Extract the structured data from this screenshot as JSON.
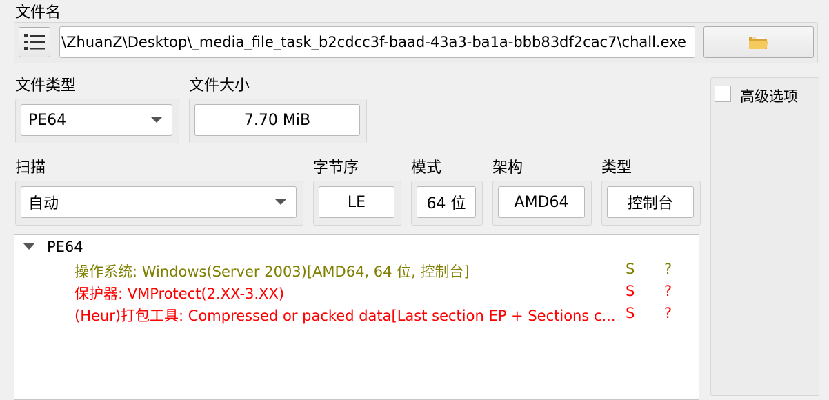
{
  "file": {
    "label": "文件名",
    "path": "\\ZhuanZ\\Desktop\\_media_file_task_b2cdcc3f-baad-43a3-ba1a-bbb83df2cac7\\chall.exe"
  },
  "file_type": {
    "label": "文件类型",
    "value": "PE64"
  },
  "file_size": {
    "label": "文件大小",
    "value": "7.70 MiB"
  },
  "scan": {
    "label": "扫描",
    "value": "自动"
  },
  "endianness": {
    "label": "字节序",
    "value": "LE"
  },
  "mode": {
    "label": "模式",
    "value": "64 位"
  },
  "arch": {
    "label": "架构",
    "value": "AMD64"
  },
  "type": {
    "label": "类型",
    "value": "控制台"
  },
  "advanced": {
    "label": "高级选项",
    "checked": false
  },
  "results": {
    "root": "PE64",
    "items": [
      {
        "text": "操作系统: Windows(Server 2003)[AMD64, 64 位, 控制台]",
        "s": "S",
        "q": "?",
        "color": "#7f7f00"
      },
      {
        "text": "保护器: VMProtect(2.XX-3.XX)",
        "s": "S",
        "q": "?",
        "color": "#ff0000"
      },
      {
        "text": "(Heur)打包工具: Compressed or packed data[Last section EP + Sections c...",
        "s": "S",
        "q": "?",
        "color": "#ff0000"
      }
    ]
  },
  "icons": {
    "menu": "list-menu-icon",
    "open": "folder-icon",
    "expand": "triangle-down-icon"
  }
}
